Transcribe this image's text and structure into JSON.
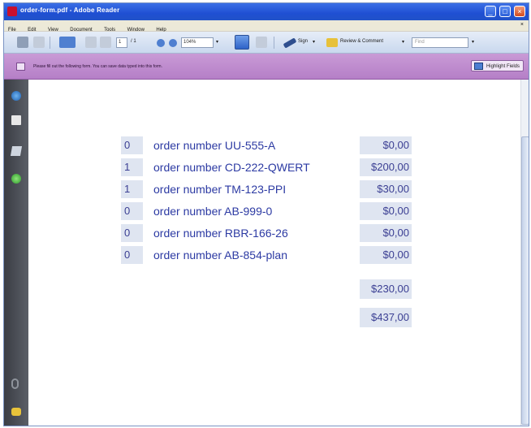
{
  "window": {
    "title": "order-form.pdf - Adobe Reader",
    "minimize_glyph": "_",
    "maximize_glyph": "□",
    "close_glyph": "×"
  },
  "menu": {
    "items": [
      "File",
      "Edit",
      "View",
      "Document",
      "Tools",
      "Window",
      "Help"
    ],
    "close_glyph": "×"
  },
  "toolbar": {
    "page_current": "1",
    "page_total": "/ 1",
    "zoom": "104%",
    "sign_label": "Sign",
    "review_label": "Review & Comment",
    "search_placeholder": "Find"
  },
  "message_bar": {
    "text": "Please fill out the following form. You can save data typed into this form.",
    "highlight_label": "Highlight Fields"
  },
  "orders": [
    {
      "qty": "0",
      "label": "order number UU-555-A",
      "price": "$0,00"
    },
    {
      "qty": "1",
      "label": "order number CD-222-QWERT",
      "price": "$200,00"
    },
    {
      "qty": "1",
      "label": "order number TM-123-PPI",
      "price": "$30,00"
    },
    {
      "qty": "0",
      "label": "order number AB-999-0",
      "price": "$0,00"
    },
    {
      "qty": "0",
      "label": "order number RBR-166-26",
      "price": "$0,00"
    },
    {
      "qty": "0",
      "label": "order number AB-854-plan",
      "price": "$0,00"
    }
  ],
  "totals": {
    "subtotal": "$230,00",
    "grand_total": "$437,00"
  },
  "colors": {
    "title_bar": "#1f4fd3",
    "message_bar": "#c99ad6",
    "field_fill": "#dfe5f1",
    "field_text": "#2c3aa3",
    "nav_pane": "#3a3d44"
  }
}
